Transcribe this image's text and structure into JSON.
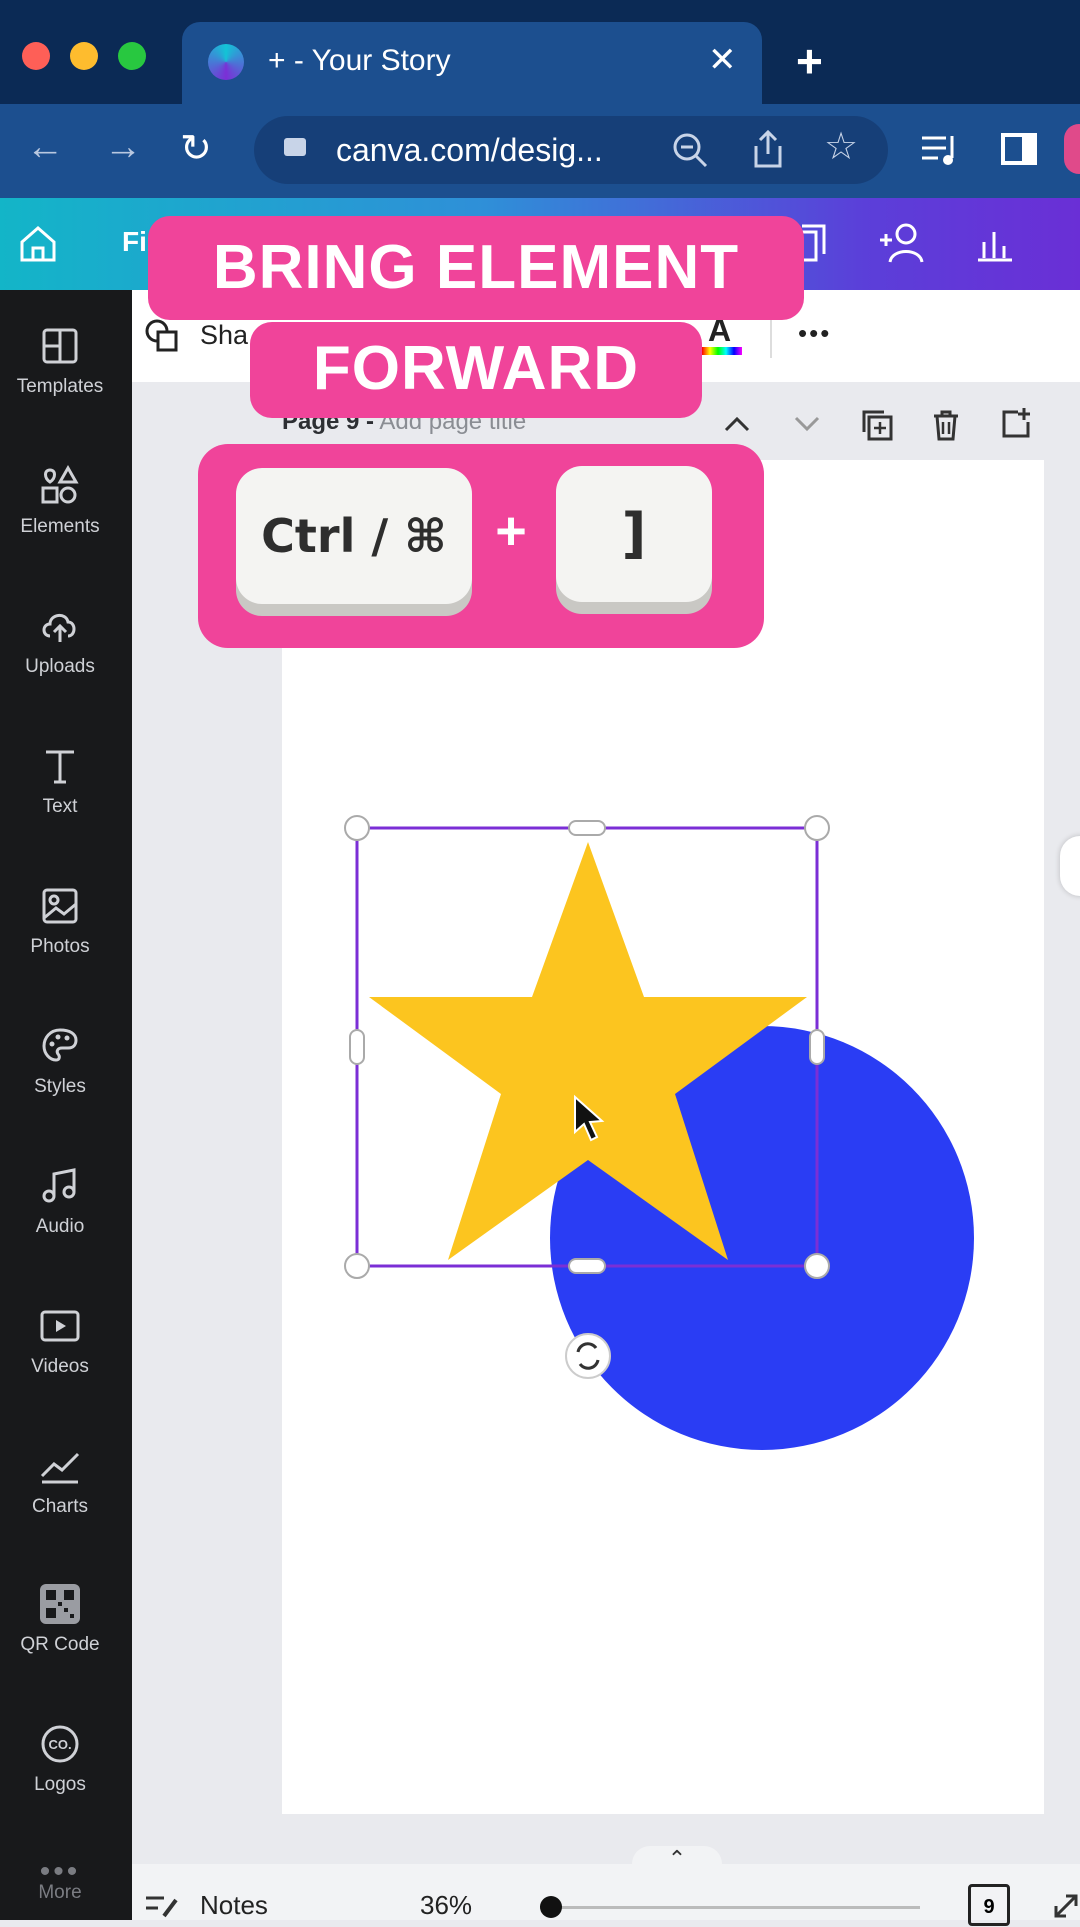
{
  "browser": {
    "tab_title": "+ - Your Story",
    "tab_close": "✕",
    "new_tab": "+",
    "url": "canva.com/desig...",
    "colors": {
      "close": "#fe5f57",
      "min": "#febc2e",
      "max": "#28c840"
    }
  },
  "canva": {
    "file_menu": "Fi",
    "shape_button": "Sha",
    "more_menu": "•••",
    "page_label": "Page 9 -",
    "page_title_placeholder": "Add page title",
    "sidebar": [
      {
        "label": "Templates",
        "icon": "templates-icon"
      },
      {
        "label": "Elements",
        "icon": "elements-icon"
      },
      {
        "label": "Uploads",
        "icon": "uploads-icon"
      },
      {
        "label": "Text",
        "icon": "text-icon"
      },
      {
        "label": "Photos",
        "icon": "photos-icon"
      },
      {
        "label": "Styles",
        "icon": "styles-icon"
      },
      {
        "label": "Audio",
        "icon": "audio-icon"
      },
      {
        "label": "Videos",
        "icon": "videos-icon"
      },
      {
        "label": "Charts",
        "icon": "charts-icon"
      },
      {
        "label": "QR Code",
        "icon": "qr-code-icon"
      },
      {
        "label": "Logos",
        "icon": "logos-icon"
      },
      {
        "label": "More",
        "icon": "more-icon"
      }
    ],
    "footer": {
      "notes": "Notes",
      "zoom": "36%",
      "page_count": "9",
      "zoom_level": 0.03
    },
    "shapes": {
      "star_color": "#fcc51f",
      "circle_color": "#2a3df4",
      "selection_color": "#7b2fd6"
    }
  },
  "overlay": {
    "banner_line1": "BRING ELEMENT",
    "banner_line2": "FORWARD",
    "key1": "Ctrl / ⌘",
    "plus": "+",
    "key2": "]",
    "accent": "#f0449a"
  }
}
